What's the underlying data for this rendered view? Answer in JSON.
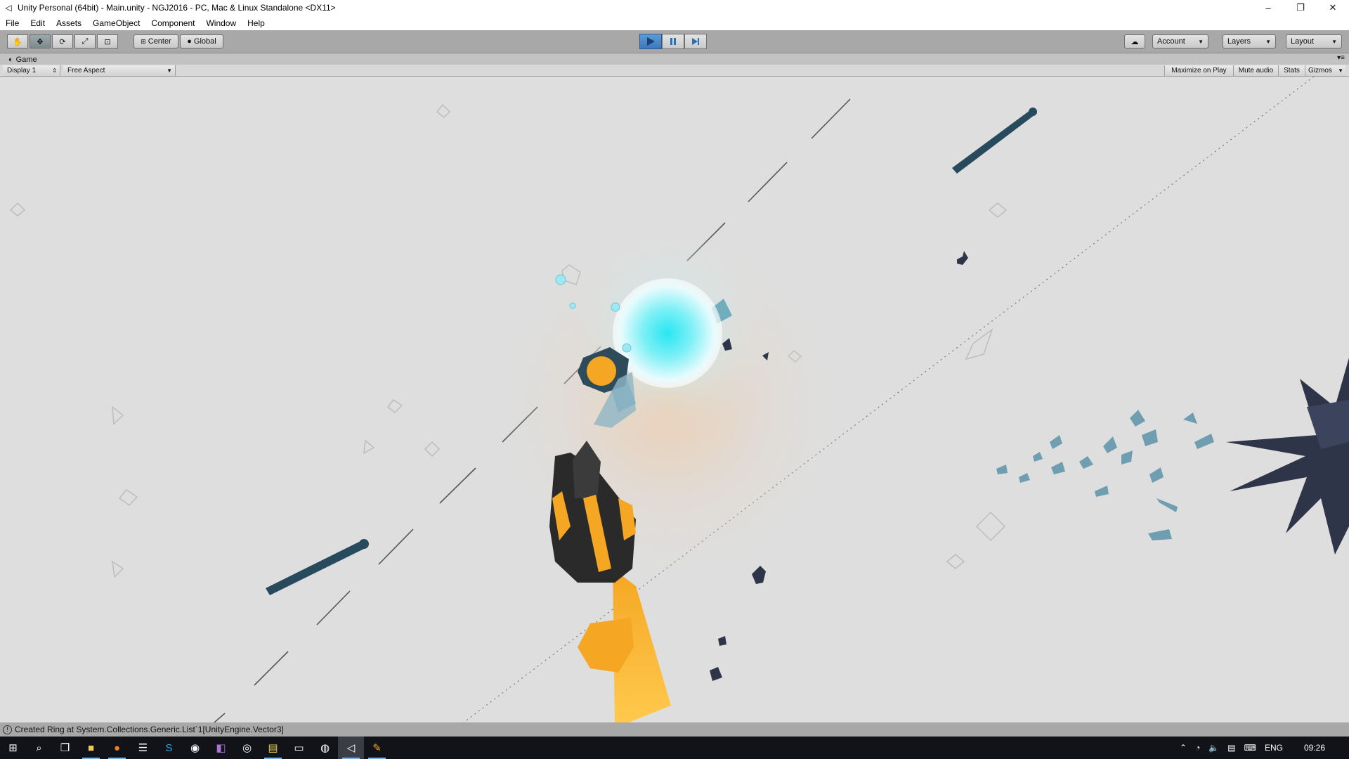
{
  "window": {
    "title": "Unity Personal (64bit) - Main.unity - NGJ2016 - PC, Mac & Linux Standalone <DX11>",
    "minimize": "–",
    "restore": "❐",
    "close": "✕"
  },
  "menu": [
    "File",
    "Edit",
    "Assets",
    "GameObject",
    "Component",
    "Window",
    "Help"
  ],
  "toolbar": {
    "pivot_label": "Center",
    "space_label": "Global",
    "account_label": "Account",
    "layers_label": "Layers",
    "layout_label": "Layout",
    "play_active": true
  },
  "game_view": {
    "tab_label": "Game",
    "display_label": "Display 1",
    "aspect_label": "Free Aspect",
    "maximize_label": "Maximize on Play",
    "mute_label": "Mute audio",
    "stats_label": "Stats",
    "gizmos_label": "Gizmos"
  },
  "status": {
    "message": "Created Ring at System.Collections.Generic.List`1[UnityEngine.Vector3]"
  },
  "taskbar": {
    "language": "ENG",
    "time": "09:26"
  },
  "colors": {
    "accent_play": "#3d79ba",
    "sky": "#dedede",
    "orb": "#39e0f0",
    "ship_orange": "#f5a623",
    "enemy_dark": "#2e3548",
    "trail": "#274a5c"
  }
}
